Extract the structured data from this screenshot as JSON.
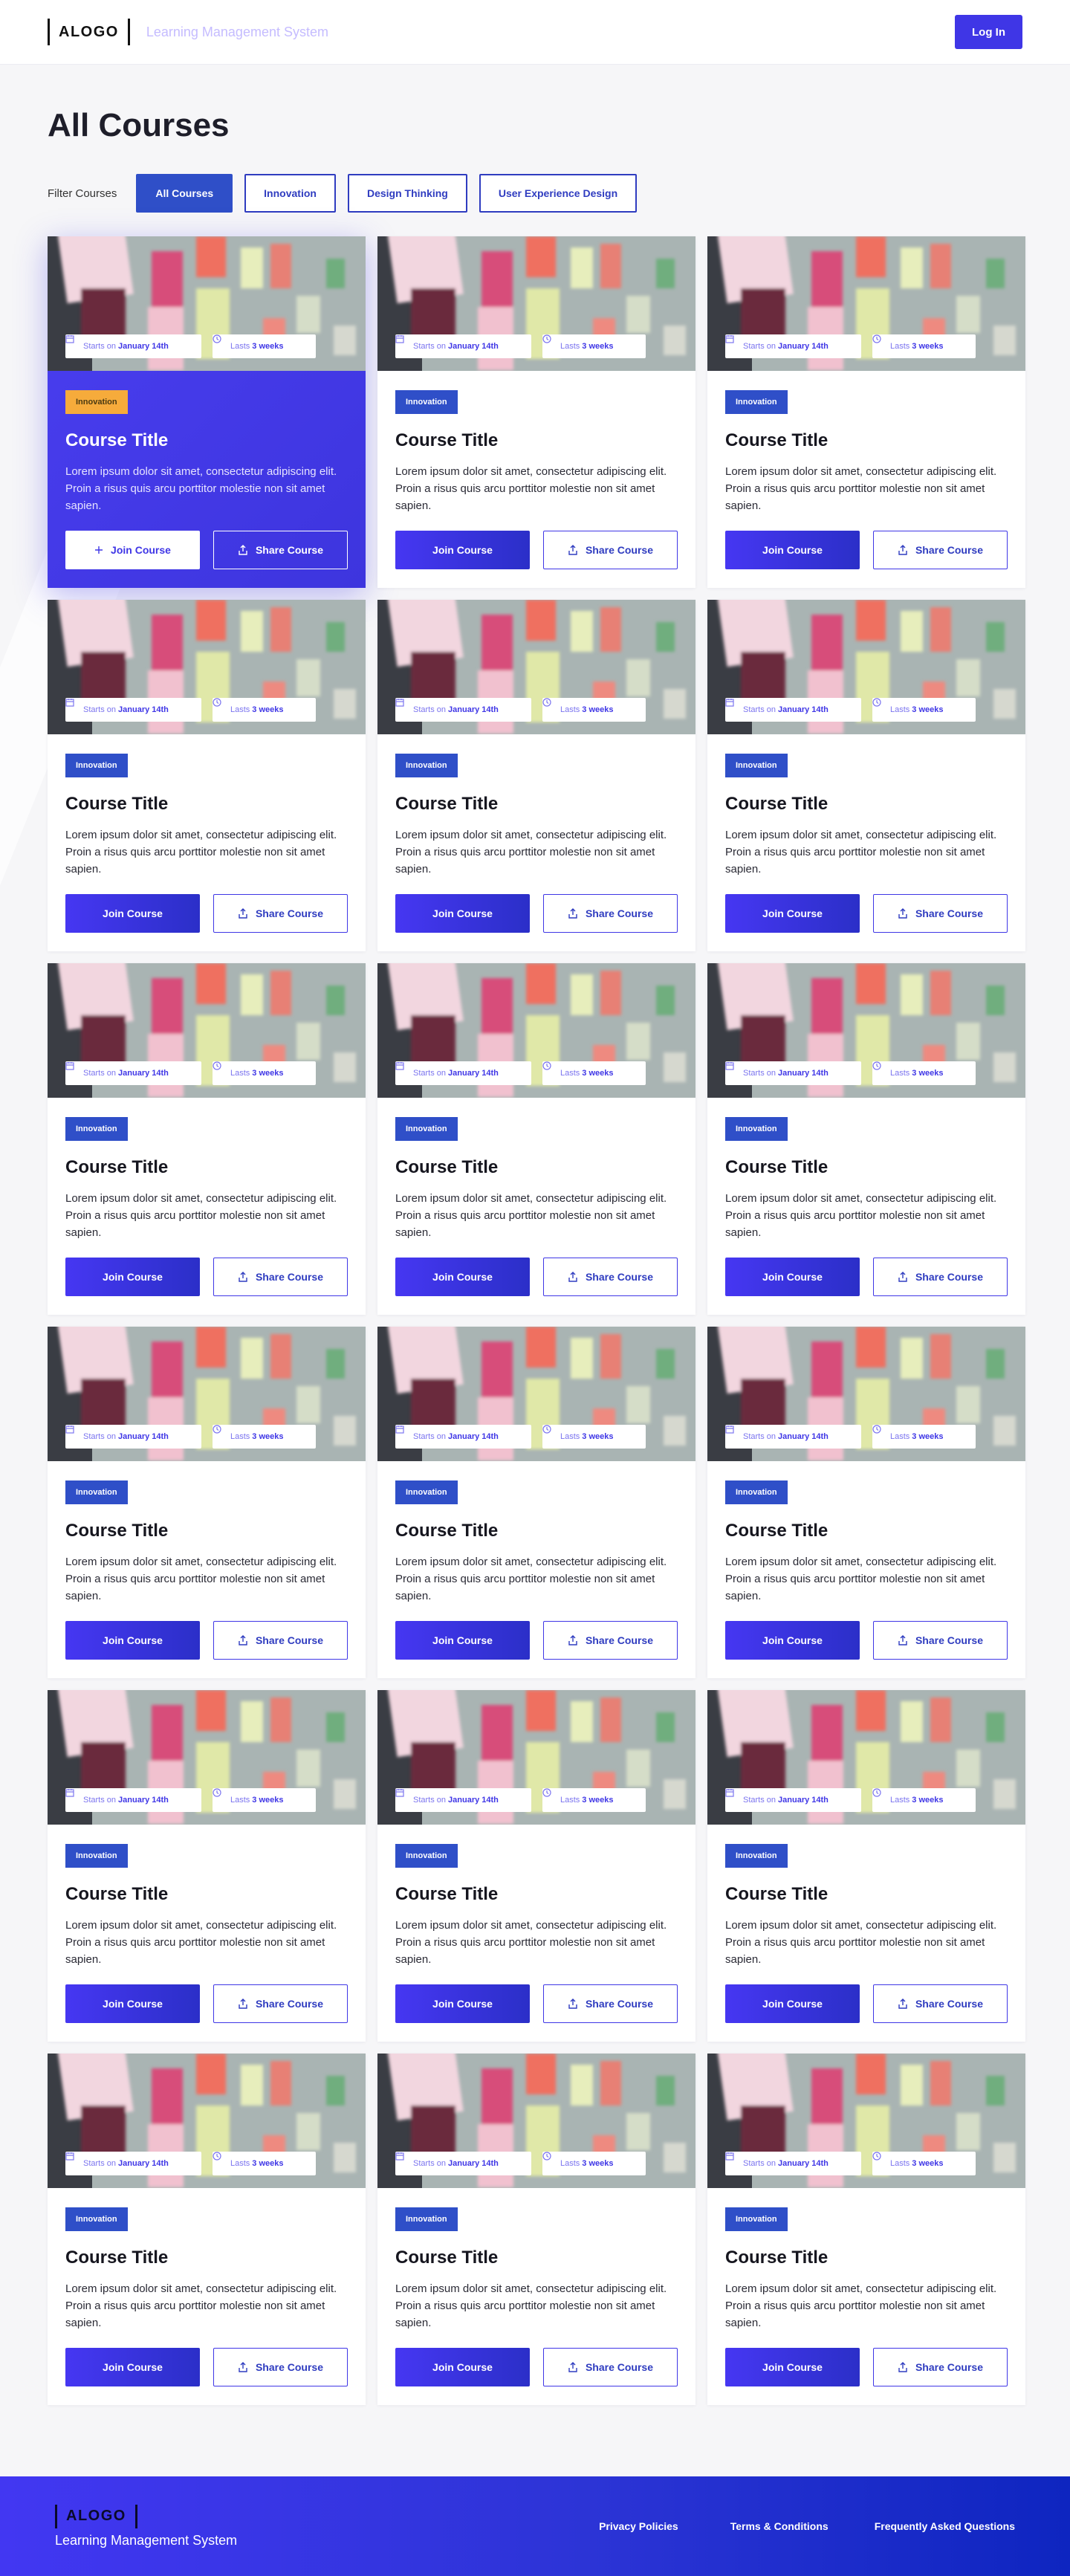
{
  "header": {
    "logo_text": "ALOGO",
    "subtitle": "Learning Management System",
    "login_label": "Log In"
  },
  "page": {
    "title": "All Courses",
    "filter_label": "Filter Courses",
    "filters": [
      {
        "label": "All Courses",
        "active": true
      },
      {
        "label": "Innovation",
        "active": false
      },
      {
        "label": "Design Thinking",
        "active": false
      },
      {
        "label": "User Experience Design",
        "active": false
      }
    ]
  },
  "card_template": {
    "starts_prefix": "Starts on",
    "starts_date": "January 14th",
    "lasts_prefix": "Lasts",
    "lasts_value": "3 weeks",
    "tag": "Innovation",
    "title": "Course Title",
    "description": "Lorem ipsum dolor sit amet, consectetur adipiscing elit. Proin a risus quis arcu porttitor molestie non sit amet sapien.",
    "join_label": "Join Course",
    "share_label": "Share Course"
  },
  "courses": [
    {
      "featured": true
    },
    {
      "featured": false
    },
    {
      "featured": false
    },
    {
      "featured": false
    },
    {
      "featured": false
    },
    {
      "featured": false
    },
    {
      "featured": false
    },
    {
      "featured": false
    },
    {
      "featured": false
    },
    {
      "featured": false
    },
    {
      "featured": false
    },
    {
      "featured": false
    },
    {
      "featured": false
    },
    {
      "featured": false
    },
    {
      "featured": false
    },
    {
      "featured": false
    },
    {
      "featured": false
    },
    {
      "featured": false
    }
  ],
  "footer": {
    "logo_text": "ALOGO",
    "subtitle": "Learning Management System",
    "links": [
      "Privacy Policies",
      "Terms & Conditions",
      "Frequently Asked Questions"
    ]
  },
  "colors": {
    "accent": "#3f36e6",
    "tag": "#2f4fc8",
    "featured_tag": "#f6ab3b"
  }
}
